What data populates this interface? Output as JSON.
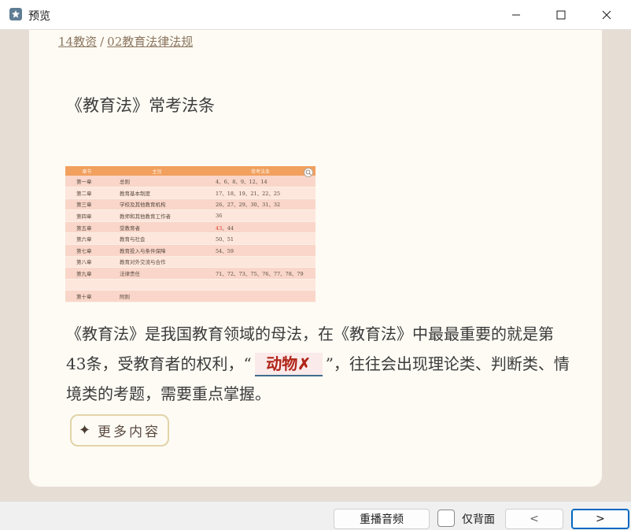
{
  "window": {
    "title": "预览"
  },
  "breadcrumb": {
    "part1": "14教资",
    "separator": "/",
    "part2": "02教育法律法规"
  },
  "heading": "《教育法》常考法条",
  "table": {
    "headers": [
      "章节",
      "主旨",
      "常考法条"
    ],
    "rows": [
      {
        "chapter": "第一章",
        "topic": "总则",
        "articles": "4、6、8、9、12、14"
      },
      {
        "chapter": "第二章",
        "topic": "教育基本制度",
        "articles": "17、18、19、21、22、25"
      },
      {
        "chapter": "第三章",
        "topic": "学校及其他教育机构",
        "articles": "26、27、29、30、31、32"
      },
      {
        "chapter": "第四章",
        "topic": "教师和其他教育工作者",
        "articles": "36"
      },
      {
        "chapter": "第五章",
        "topic": "受教育者",
        "articles_red": "43",
        "articles": "、44"
      },
      {
        "chapter": "第六章",
        "topic": "教育与社会",
        "articles": "50、51"
      },
      {
        "chapter": "第七章",
        "topic": "教育投入与条件保障",
        "articles": "54、59"
      },
      {
        "chapter": "第八章",
        "topic": "教育对外交流与合作",
        "articles": ""
      },
      {
        "chapter": "第九章",
        "topic": "法律责任",
        "articles": "71、72、73、75、76、77、78、79"
      },
      {
        "chapter": "",
        "topic": "",
        "articles": ""
      },
      {
        "chapter": "第十章",
        "topic": "附则",
        "articles": ""
      }
    ]
  },
  "paragraph": {
    "before": "《教育法》是我国教育领域的母法，在《教育法》中最最重要的就是第43条，受教育者的权利，“",
    "answer": "动物✗",
    "after": "”，往往会出现理论类、判断类、情境类的考题，需要重点掌握。"
  },
  "more_button": {
    "icon": "sparkle-icon",
    "label": "更多内容"
  },
  "bottombar": {
    "replay_label": "重播音频",
    "back_only_label": "仅背面",
    "back_only_checked": false,
    "prev_label": "<",
    "next_label": ">"
  },
  "colors": {
    "accent": "#0067c0",
    "card_bg": "#fdfbf4",
    "table_header": "#f1a05e",
    "answer": "#b02418"
  }
}
